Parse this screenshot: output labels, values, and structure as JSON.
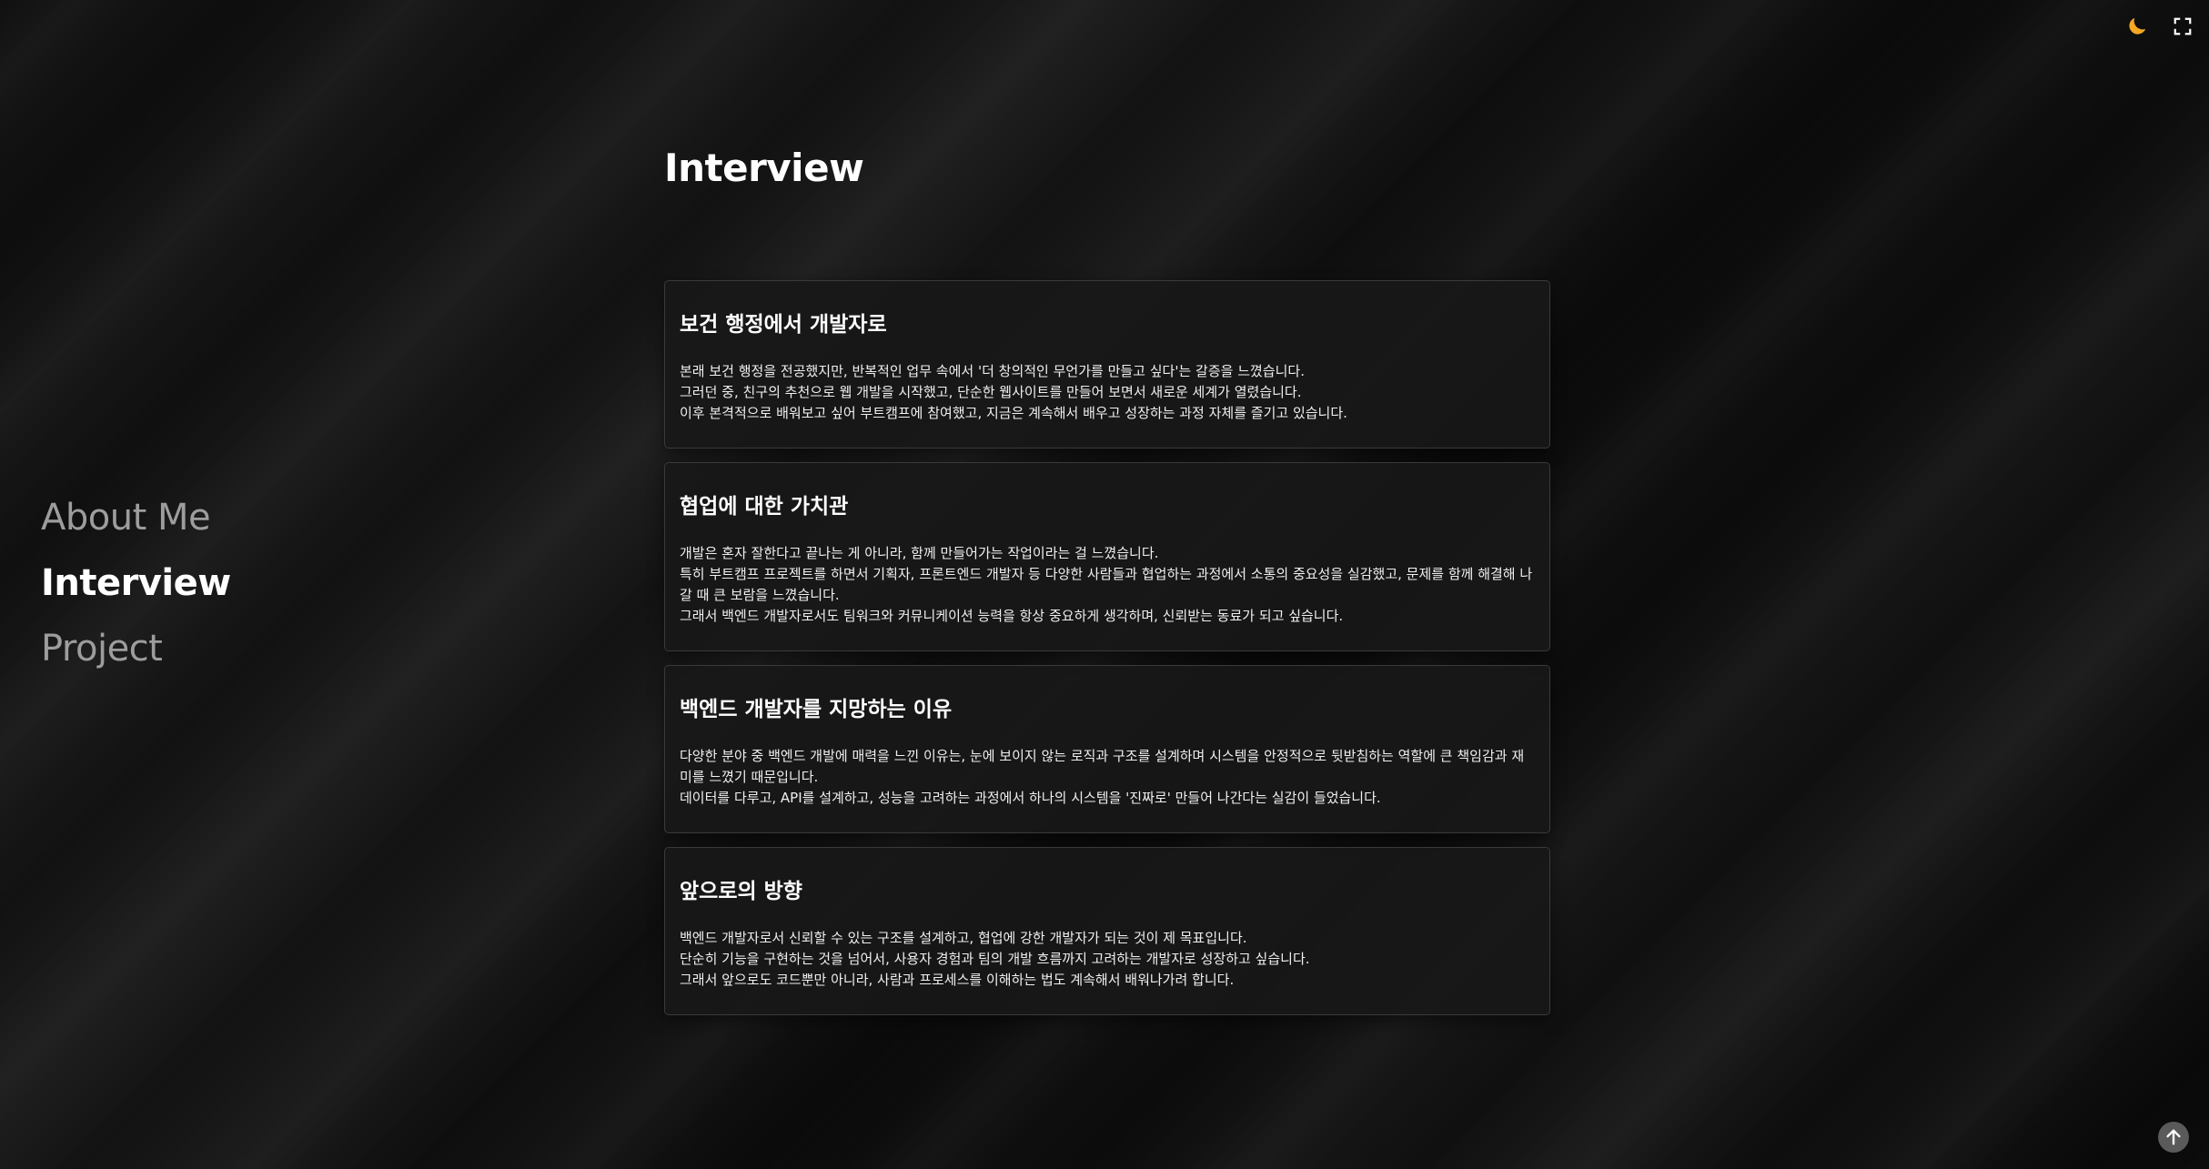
{
  "controls": {
    "theme_icon": "moon-icon",
    "fullscreen_icon": "fullscreen-icon",
    "scroll_top_icon": "arrow-up-icon",
    "accent_color": "#f5a623"
  },
  "nav": {
    "items": [
      {
        "label": "About Me",
        "active": false
      },
      {
        "label": "Interview",
        "active": true
      },
      {
        "label": "Project",
        "active": false
      }
    ]
  },
  "main": {
    "title": "Interview",
    "cards": [
      {
        "title": "보건 행정에서 개발자로",
        "lines": [
          "본래 보건 행정을 전공했지만, 반복적인 업무 속에서 '더 창의적인 무언가를 만들고 싶다'는 갈증을 느꼈습니다.",
          "그러던 중, 친구의 추천으로 웹 개발을 시작했고, 단순한 웹사이트를 만들어 보면서 새로운 세계가 열렸습니다.",
          "이후 본격적으로 배워보고 싶어 부트캠프에 참여했고, 지금은 계속해서 배우고 성장하는 과정 자체를 즐기고 있습니다."
        ]
      },
      {
        "title": "협업에 대한 가치관",
        "lines": [
          "개발은 혼자 잘한다고 끝나는 게 아니라, 함께 만들어가는 작업이라는 걸 느꼈습니다.",
          "특히 부트캠프 프로젝트를 하면서 기획자, 프론트엔드 개발자 등 다양한 사람들과 협업하는 과정에서 소통의 중요성을 실감했고, 문제를 함께 해결해 나갈 때 큰 보람을 느꼈습니다.",
          "그래서 백엔드 개발자로서도 팀워크와 커뮤니케이션 능력을 항상 중요하게 생각하며, 신뢰받는 동료가 되고 싶습니다."
        ]
      },
      {
        "title": "백엔드 개발자를 지망하는 이유",
        "lines": [
          "다양한 분야 중 백엔드 개발에 매력을 느낀 이유는, 눈에 보이지 않는 로직과 구조를 설계하며 시스템을 안정적으로 뒷받침하는 역할에 큰 책임감과 재미를 느꼈기 때문입니다.",
          "데이터를 다루고, API를 설계하고, 성능을 고려하는 과정에서 하나의 시스템을 '진짜로' 만들어 나간다는 실감이 들었습니다."
        ]
      },
      {
        "title": "앞으로의 방향",
        "lines": [
          "백엔드 개발자로서 신뢰할 수 있는 구조를 설계하고, 협업에 강한 개발자가 되는 것이 제 목표입니다.",
          "단순히 기능을 구현하는 것을 넘어서, 사용자 경험과 팀의 개발 흐름까지 고려하는 개발자로 성장하고 싶습니다.",
          "그래서 앞으로도 코드뿐만 아니라, 사람과 프로세스를 이해하는 법도 계속해서 배워나가려 합니다."
        ]
      }
    ]
  }
}
